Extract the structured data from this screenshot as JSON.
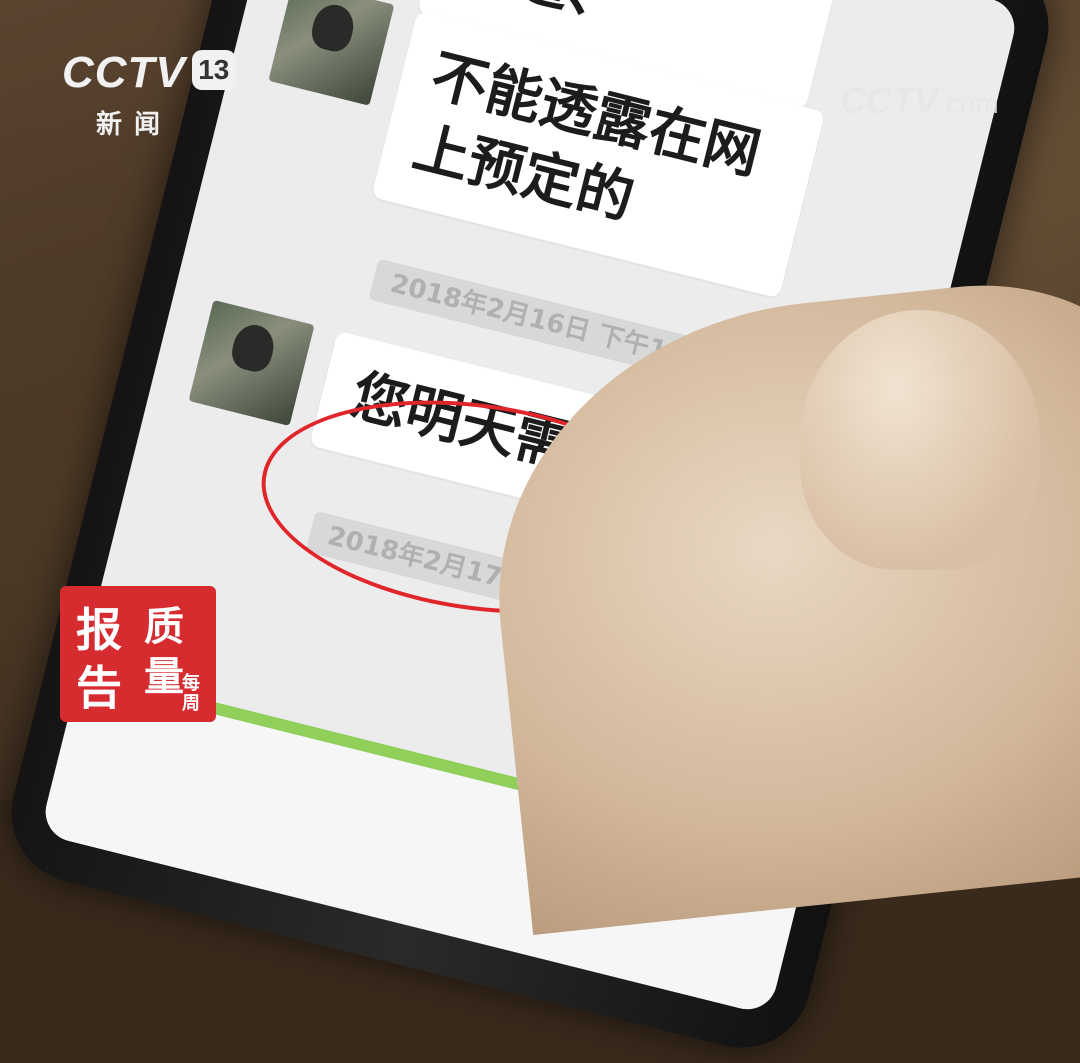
{
  "broadcast": {
    "channel_logo": "CCTV",
    "channel_number": "13",
    "channel_subtitle": "新闻",
    "watermark": "CCTV",
    "watermark_suffix": ".com"
  },
  "program_seal": {
    "chars": [
      "报",
      "质",
      "告",
      "量",
      "每周"
    ]
  },
  "chat": {
    "messages": [
      {
        "text": "不能透露预订渠道、"
      },
      {
        "text": "不能透露在网上预定的"
      },
      {
        "text": "您明天需要退房"
      }
    ],
    "timestamps": [
      "2018年2月16日 下午10:55",
      "2018年2月17日 下午5:31"
    ]
  },
  "colors": {
    "highlight": "#e0262b",
    "chat_background": "#ececec",
    "bubble": "#ffffff",
    "accent_bar": "#8fcf5a",
    "seal": "#d62b2f"
  }
}
